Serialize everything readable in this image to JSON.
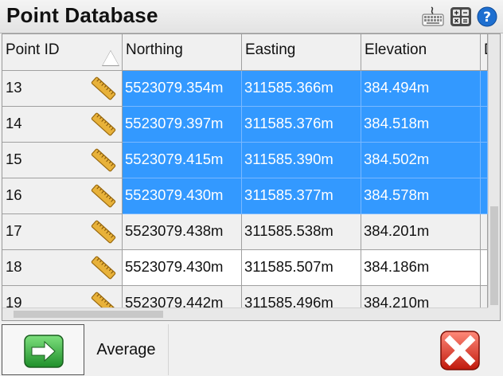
{
  "window": {
    "title": "Point Database"
  },
  "toolbar": {
    "icons": [
      "keyboard-icon",
      "calculator-icon",
      "help-icon"
    ]
  },
  "table": {
    "columns": [
      "Point ID",
      "Northing",
      "Easting",
      "Elevation",
      "D"
    ],
    "rows": [
      {
        "id": "13",
        "northing": "5523079.354m",
        "easting": "311585.366m",
        "elevation": "384.494m"
      },
      {
        "id": "14",
        "northing": "5523079.397m",
        "easting": "311585.376m",
        "elevation": "384.518m"
      },
      {
        "id": "15",
        "northing": "5523079.415m",
        "easting": "311585.390m",
        "elevation": "384.502m"
      },
      {
        "id": "16",
        "northing": "5523079.430m",
        "easting": "311585.377m",
        "elevation": "384.578m"
      },
      {
        "id": "17",
        "northing": "5523079.438m",
        "easting": "311585.538m",
        "elevation": "384.201m"
      },
      {
        "id": "18",
        "northing": "5523079.430m",
        "easting": "311585.507m",
        "elevation": "384.186m"
      },
      {
        "id": "19",
        "northing": "5523079.442m",
        "easting": "311585.496m",
        "elevation": "384.210m"
      }
    ],
    "selected_rows": [
      "13",
      "14",
      "15",
      "16"
    ],
    "row_icon": "ruler-icon",
    "selection_color": "#3399ff"
  },
  "bottom": {
    "average_label": "Average"
  }
}
